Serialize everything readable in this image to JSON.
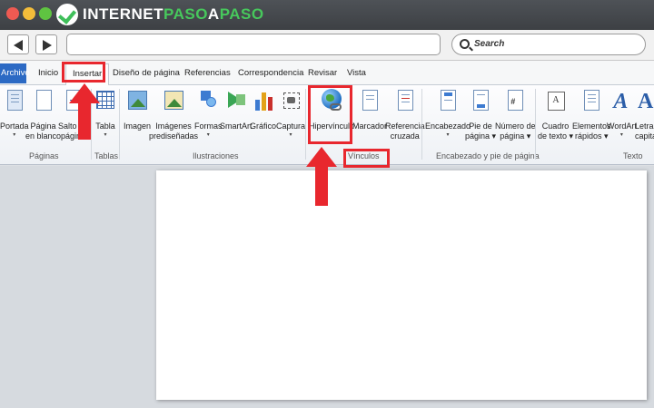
{
  "brand": {
    "logo_text_1": "INTERNET",
    "logo_text_2": "PASO",
    "logo_text_3": "A",
    "logo_text_4": "PASO"
  },
  "browser": {
    "search_placeholder": "Search",
    "url_value": ""
  },
  "ribbon_tabs": [
    {
      "label": "Archivo"
    },
    {
      "label": "Inicio"
    },
    {
      "label": "Insertar",
      "active": true
    },
    {
      "label": "Diseño de página"
    },
    {
      "label": "Referencias"
    },
    {
      "label": "Correspondencia"
    },
    {
      "label": "Revisar"
    },
    {
      "label": "Vista"
    }
  ],
  "groups": {
    "paginas": {
      "label": "Páginas",
      "buttons": [
        {
          "label": "Portada",
          "dropdown": "▾"
        },
        {
          "label": "Página\nen blanco"
        },
        {
          "label": "Salto de\npágina"
        }
      ]
    },
    "tablas": {
      "label": "Tablas",
      "buttons": [
        {
          "label": "Tabla",
          "dropdown": "▾"
        }
      ]
    },
    "ilustraciones": {
      "label": "Ilustraciones",
      "buttons": [
        {
          "label": "Imagen"
        },
        {
          "label": "Imágenes\nprediseñadas"
        },
        {
          "label": "Formas",
          "dropdown": "▾"
        },
        {
          "label": "SmartArt"
        },
        {
          "label": "Gráfico"
        },
        {
          "label": "Captura",
          "dropdown": "▾"
        }
      ]
    },
    "vinculos": {
      "label": "Vínculos",
      "buttons": [
        {
          "label": "Hipervínculo"
        },
        {
          "label": "Marcador"
        },
        {
          "label": "Referencia\ncruzada"
        }
      ]
    },
    "encabezado": {
      "label": "Encabezado y pie de página",
      "buttons": [
        {
          "label": "Encabezado",
          "dropdown": "▾"
        },
        {
          "label": "Pie de\npágina ▾"
        },
        {
          "label": "Número de\npágina ▾"
        }
      ]
    },
    "texto": {
      "label": "Texto",
      "buttons": [
        {
          "label": "Cuadro\nde texto ▾"
        },
        {
          "label": "Elementos\nrápidos ▾"
        },
        {
          "label": "WordArt",
          "dropdown": "▾"
        },
        {
          "label": "Letra\ncapital"
        }
      ]
    }
  },
  "colors": {
    "accent_red": "#e8272e",
    "file_tab": "#2c6ac4",
    "brand_green": "#47c85c"
  }
}
